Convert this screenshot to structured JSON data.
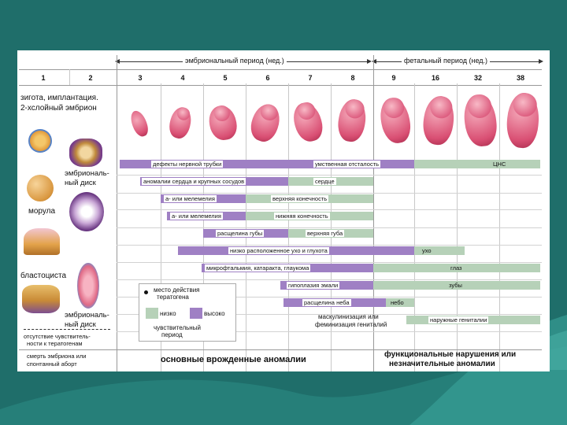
{
  "periods": {
    "embryonic": "эмбриональный период (нед.)",
    "fetal": "фетальный период (нед.)"
  },
  "weeks": [
    "1",
    "2",
    "3",
    "4",
    "5",
    "6",
    "7",
    "8",
    "9",
    "16",
    "32",
    "38"
  ],
  "left_panel": {
    "zygote": "зигота, имплантация.",
    "bilayer": "2-хслойный эмбрион",
    "disc1_a": "эмбриональ-",
    "disc1_b": "ный диск",
    "morula": "морула",
    "blastocyst": "бластоциста",
    "disc2_a": "эмбриональ-",
    "disc2_b": "ный диск",
    "insens_a": "отсутствие чувствитель-",
    "insens_b": "ности к тератогенам",
    "death_a": "смерть эмбриона или",
    "death_b": "спонтанный аборт"
  },
  "bars": {
    "neural_tube": "дефекты нервной трубки",
    "mental": "умственная отсталость",
    "cns": "ЦНС",
    "heart_vessels": "аномалии сердца и крупных сосудов",
    "heart": "сердце",
    "amelia_upper": "а- или мелемелия",
    "upper_limb": "верхняя конечность",
    "amelia_lower": "а- или мелемелия",
    "lower_limb": "нижняя конечность",
    "cleft_lip": "расщелина губы",
    "upper_lip": "верхняя губа",
    "low_ears": "низко расположенное ухо и глухота",
    "ear": "ухо",
    "eye_defects": "микрофтальмия, катаракта, глаукома",
    "eye": "глаз",
    "enamel": "гипоплазия эмали",
    "teeth": "зубы",
    "cleft_palate": "расщелина неба",
    "palate": "небо",
    "masc_a": "маскулинизация или",
    "masc_b": "феминизация гениталий",
    "genitals": "наружные гениталии"
  },
  "legend": {
    "site_a": "место действия",
    "site_b": "тератогена",
    "low": "низко",
    "high": "высоко",
    "sens_a": "чувствительный",
    "sens_b": "период"
  },
  "footer": {
    "main": "основные врожденные аномалии",
    "minor_a": "функциональные нарушения или",
    "minor_b": "незначительные аномалии"
  },
  "colors": {
    "background": "#1f6e6a",
    "high_sensitivity": "#9f80c4",
    "low_sensitivity": "#b6d1b8",
    "embryo": "#d94f73"
  }
}
